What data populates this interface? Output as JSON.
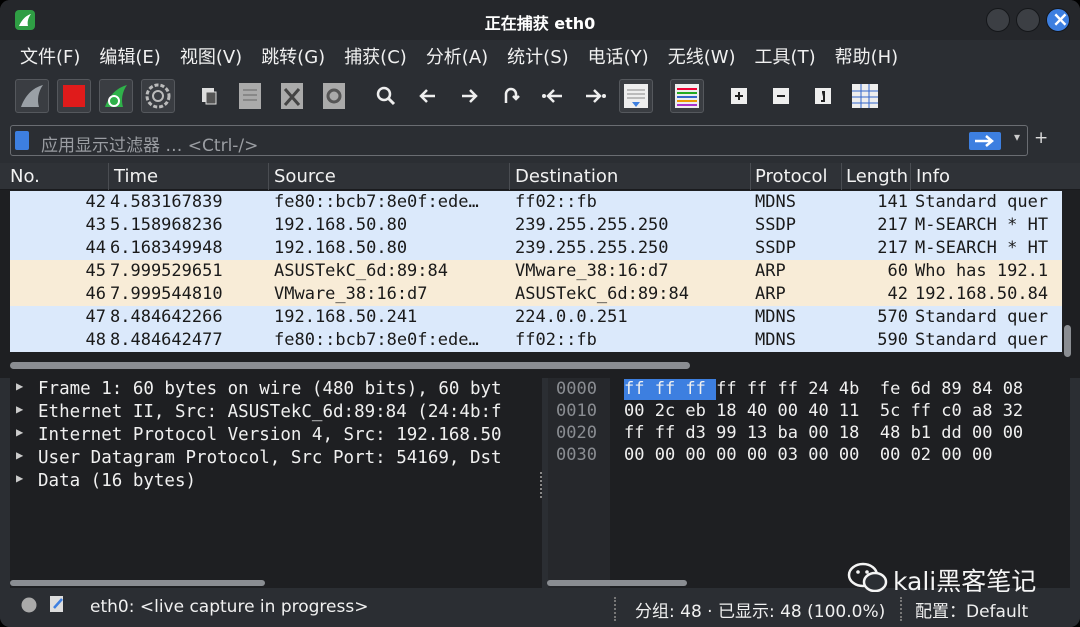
{
  "window": {
    "title": "正在捕获 eth0"
  },
  "menu": [
    "文件(F)",
    "编辑(E)",
    "视图(V)",
    "跳转(G)",
    "捕获(C)",
    "分析(A)",
    "统计(S)",
    "电话(Y)",
    "无线(W)",
    "工具(T)",
    "帮助(H)"
  ],
  "filter": {
    "placeholder": "应用显示过滤器 … <Ctrl-/>"
  },
  "columns": {
    "no": "No.",
    "time": "Time",
    "source": "Source",
    "destination": "Destination",
    "protocol": "Protocol",
    "length": "Length",
    "info": "Info"
  },
  "packets": [
    {
      "no": "42",
      "time": "4.583167839",
      "source": "fe80::bcb7:8e0f:ede…",
      "destination": "ff02::fb",
      "protocol": "MDNS",
      "length": "141",
      "info": "Standard quer",
      "color": "#dbe9fb"
    },
    {
      "no": "43",
      "time": "5.158968236",
      "source": "192.168.50.80",
      "destination": "239.255.255.250",
      "protocol": "SSDP",
      "length": "217",
      "info": "M-SEARCH * HT",
      "color": "#dbe9fb"
    },
    {
      "no": "44",
      "time": "6.168349948",
      "source": "192.168.50.80",
      "destination": "239.255.255.250",
      "protocol": "SSDP",
      "length": "217",
      "info": "M-SEARCH * HT",
      "color": "#dbe9fb"
    },
    {
      "no": "45",
      "time": "7.999529651",
      "source": "ASUSTekC_6d:89:84",
      "destination": "VMware_38:16:d7",
      "protocol": "ARP",
      "length": "60",
      "info": "Who has 192.1",
      "color": "#f8ecd7"
    },
    {
      "no": "46",
      "time": "7.999544810",
      "source": "VMware_38:16:d7",
      "destination": "ASUSTekC_6d:89:84",
      "protocol": "ARP",
      "length": "42",
      "info": "192.168.50.84",
      "color": "#f8ecd7"
    },
    {
      "no": "47",
      "time": "8.484642266",
      "source": "192.168.50.241",
      "destination": "224.0.0.251",
      "protocol": "MDNS",
      "length": "570",
      "info": "Standard quer",
      "color": "#dbe9fb"
    },
    {
      "no": "48",
      "time": "8.484642477",
      "source": "fe80::bcb7:8e0f:ede…",
      "destination": "ff02::fb",
      "protocol": "MDNS",
      "length": "590",
      "info": "Standard quer",
      "color": "#dbe9fb"
    }
  ],
  "details": [
    "Frame 1: 60 bytes on wire (480 bits), 60 byt",
    "Ethernet II, Src: ASUSTekC_6d:89:84 (24:4b:f",
    "Internet Protocol Version 4, Src: 192.168.50",
    "User Datagram Protocol, Src Port: 54169, Dst",
    "Data (16 bytes)"
  ],
  "hex": [
    {
      "offset": "0000",
      "bytes": "ff ff ff ff ff ff 24 4b  fe 6d 89 84 08"
    },
    {
      "offset": "0010",
      "bytes": "00 2c eb 18 40 00 40 11  5c ff c0 a8 32"
    },
    {
      "offset": "0020",
      "bytes": "ff ff d3 99 13 ba 00 18  48 b1 dd 00 00"
    },
    {
      "offset": "0030",
      "bytes": "00 00 00 00 00 03 00 00  00 02 00 00"
    }
  ],
  "status": {
    "capture": "eth0: <live capture in progress>",
    "counts": "分组: 48 · 已显示: 48 (100.0%)",
    "profile": "配置：Default"
  },
  "watermark": "kali黑客笔记",
  "icons": [
    "shark-fin-start-icon",
    "stop-icon",
    "restart-icon",
    "options-gear-icon",
    "open-file-icon",
    "save-file-icon",
    "close-file-icon",
    "reload-icon",
    "search-icon",
    "back-arrow-icon",
    "forward-arrow-icon",
    "goto-packet-icon",
    "first-packet-icon",
    "last-packet-icon",
    "autoscroll-icon",
    "colorize-icon",
    "zoom-in-icon",
    "zoom-out-icon",
    "normal-size-icon",
    "resize-columns-icon"
  ]
}
